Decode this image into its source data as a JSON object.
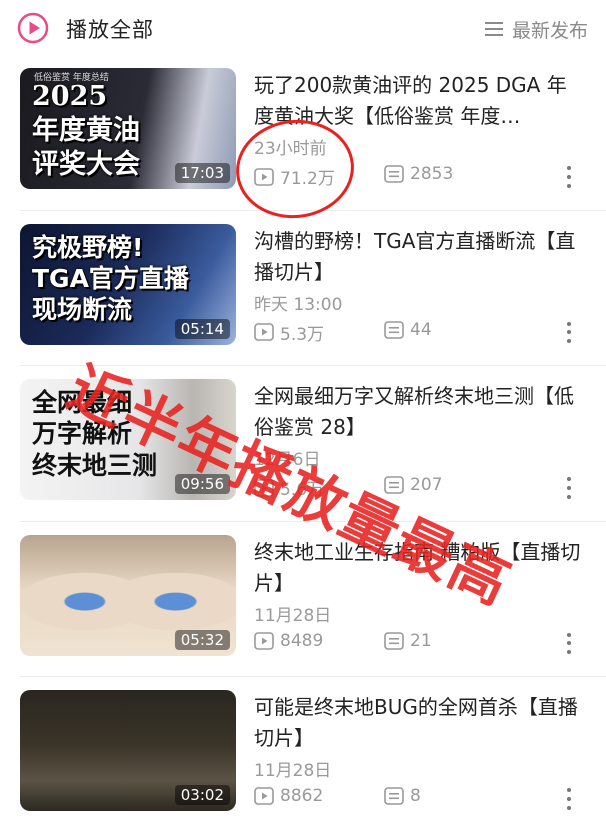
{
  "header": {
    "play_all_label": "播放全部",
    "sort_label": "最新发布"
  },
  "videos": [
    {
      "thumb_text": "2025\n年度黄油\n评奖大会",
      "thumb_caption": "低俗鉴赏 年度总结",
      "duration": "17:03",
      "title": "玩了200款黄油评的 2025 DGA 年度黄油大奖【低俗鉴赏 年度…",
      "date": "23小时前",
      "views": "71.2万",
      "comments": "2853"
    },
    {
      "thumb_text": "究极野榜!\nTGA官方直播\n现场断流",
      "duration": "05:14",
      "title": "沟槽的野榜！TGA官方直播断流【直播切片】",
      "date": "昨天 13:00",
      "views": "5.3万",
      "comments": "44"
    },
    {
      "thumb_text": "全网最细\n万字解析\n终末地三测",
      "duration": "09:56",
      "title": "全网最细万字又解析终末地三测【低俗鉴赏 28】",
      "date": "12月6日",
      "views": "5.6万",
      "comments": "207"
    },
    {
      "thumb_text": "",
      "duration": "05:32",
      "title": "终末地工业生存指南 糟粕版【直播切片】",
      "date": "11月28日",
      "views": "8489",
      "comments": "21"
    },
    {
      "thumb_text": "",
      "duration": "03:02",
      "title": "可能是终末地BUG的全网首杀【直播切片】",
      "date": "11月28日",
      "views": "8862",
      "comments": "8"
    }
  ],
  "annotation": {
    "overlay_text": "近半年播放量最高"
  },
  "colors": {
    "accent": "#e84a8a",
    "annotation_red": "#e8221f",
    "meta_gray": "#999999"
  }
}
